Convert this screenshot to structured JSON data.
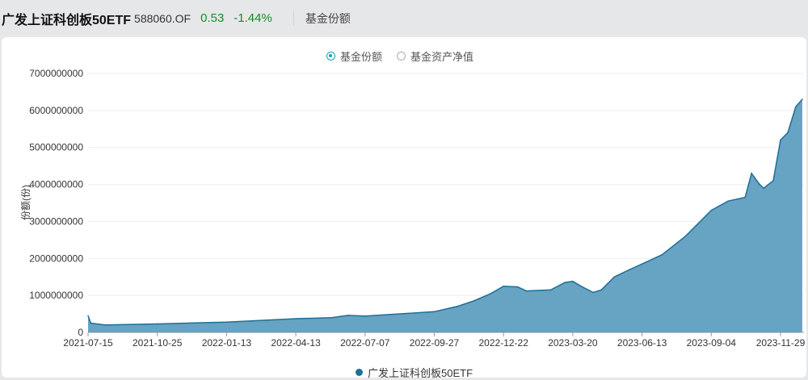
{
  "header": {
    "fund_name": "广发上证科创板50ETF",
    "code": "588060.OF",
    "price": "0.53",
    "change": "-1.44%",
    "tab": "基金份额",
    "change_color": "#1a8a2a"
  },
  "radios": [
    {
      "label": "基金份额",
      "selected": true
    },
    {
      "label": "基金资产净值",
      "selected": false
    }
  ],
  "chart_data": {
    "type": "area",
    "ylabel": "份额(份)",
    "ylim": [
      0,
      7000000000
    ],
    "yticks": [
      "0",
      "1000000000",
      "2000000000",
      "3000000000",
      "4000000000",
      "5000000000",
      "6000000000",
      "7000000000"
    ],
    "xticks": [
      "2021-07-15",
      "2021-10-25",
      "2022-01-13",
      "2022-04-13",
      "2022-07-07",
      "2022-09-27",
      "2022-12-22",
      "2023-03-20",
      "2023-06-13",
      "2023-09-04",
      "2023-11-29"
    ],
    "grid": true,
    "legend_position": "bottom",
    "color": "#1f6f96",
    "fill": "#5f9ebf",
    "series": [
      {
        "name": "广发上证科创板50ETF",
        "points": [
          [
            "2021-07-15",
            450000000
          ],
          [
            "2021-07-19",
            250000000
          ],
          [
            "2021-08-10",
            200000000
          ],
          [
            "2021-10-25",
            230000000
          ],
          [
            "2022-01-13",
            280000000
          ],
          [
            "2022-04-13",
            370000000
          ],
          [
            "2022-05-27",
            400000000
          ],
          [
            "2022-06-16",
            460000000
          ],
          [
            "2022-07-07",
            440000000
          ],
          [
            "2022-09-27",
            560000000
          ],
          [
            "2022-10-25",
            700000000
          ],
          [
            "2022-11-15",
            850000000
          ],
          [
            "2022-12-06",
            1050000000
          ],
          [
            "2022-12-22",
            1250000000
          ],
          [
            "2023-01-09",
            1230000000
          ],
          [
            "2023-01-20",
            1120000000
          ],
          [
            "2023-02-20",
            1150000000
          ],
          [
            "2023-03-10",
            1350000000
          ],
          [
            "2023-03-20",
            1380000000
          ],
          [
            "2023-03-30",
            1250000000
          ],
          [
            "2023-04-14",
            1080000000
          ],
          [
            "2023-04-24",
            1150000000
          ],
          [
            "2023-05-10",
            1500000000
          ],
          [
            "2023-05-29",
            1700000000
          ],
          [
            "2023-06-13",
            1850000000
          ],
          [
            "2023-07-07",
            2100000000
          ],
          [
            "2023-08-04",
            2600000000
          ],
          [
            "2023-09-04",
            3300000000
          ],
          [
            "2023-09-25",
            3550000000
          ],
          [
            "2023-10-16",
            3650000000
          ],
          [
            "2023-10-24",
            4300000000
          ],
          [
            "2023-11-03",
            4000000000
          ],
          [
            "2023-11-08",
            3900000000
          ],
          [
            "2023-11-20",
            4100000000
          ],
          [
            "2023-11-29",
            5200000000
          ],
          [
            "2023-12-08",
            5400000000
          ],
          [
            "2023-12-18",
            6100000000
          ],
          [
            "2023-12-26",
            6300000000
          ]
        ]
      }
    ]
  }
}
